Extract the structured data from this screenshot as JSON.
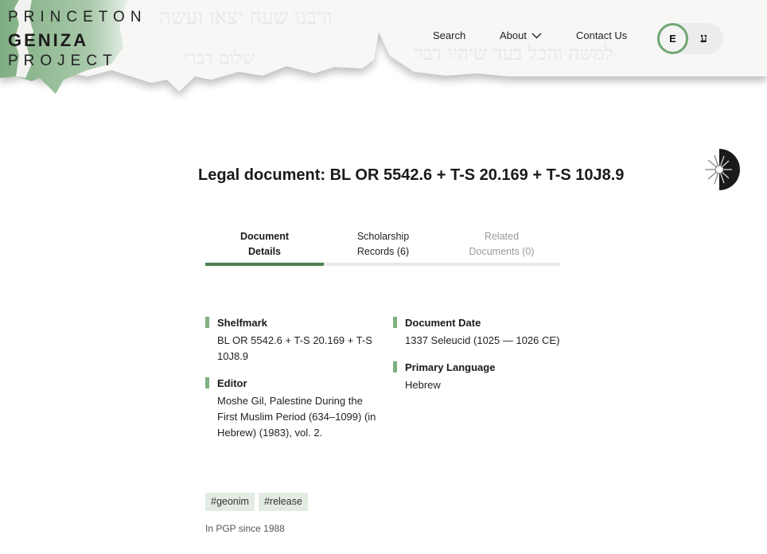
{
  "header": {
    "logo": {
      "line1": "PRINCETON",
      "line2": "GENIZA",
      "line3": "PROJECT"
    },
    "nav": [
      {
        "label": "Search"
      },
      {
        "label": "About",
        "icon": "chevron-down-icon"
      },
      {
        "label": "Contact Us"
      }
    ],
    "language": {
      "english": "E",
      "hebrew": "ע",
      "active": "english"
    },
    "colors": {
      "accent": "#6fa772",
      "logo_green": "#8fb993"
    }
  },
  "theme_toggle": {
    "icon": "sun-moon-icon"
  },
  "document": {
    "type_label": "Legal document:",
    "shelfmark_title": " BL OR 5542.6 + T-S 20.169 + T-S 10J8.9"
  },
  "tabs": [
    {
      "label_line1": "Document",
      "label_line2": "Details",
      "active": true
    },
    {
      "label_line1": "Scholarship",
      "label_line2": "Records (6)",
      "active": false
    },
    {
      "label_line1": "Related",
      "label_line2": "Documents (0)",
      "disabled": true
    }
  ],
  "details": {
    "shelfmark": {
      "label": "Shelfmark",
      "value": "BL OR 5542.6 + T-S 20.169 + T-S 10J8.9"
    },
    "editor": {
      "label": "Editor",
      "value": "Moshe Gil, Palestine During the First Muslim Period (634–1099) (in Hebrew) (1983), vol. 2."
    },
    "date": {
      "label": "Document Date",
      "value": "1337 Seleucid (1025 — 1026 CE)"
    },
    "language": {
      "label": "Primary Language",
      "value": "Hebrew"
    }
  },
  "tags": [
    "#geonim",
    "#release"
  ],
  "since": "In PGP since 1988"
}
